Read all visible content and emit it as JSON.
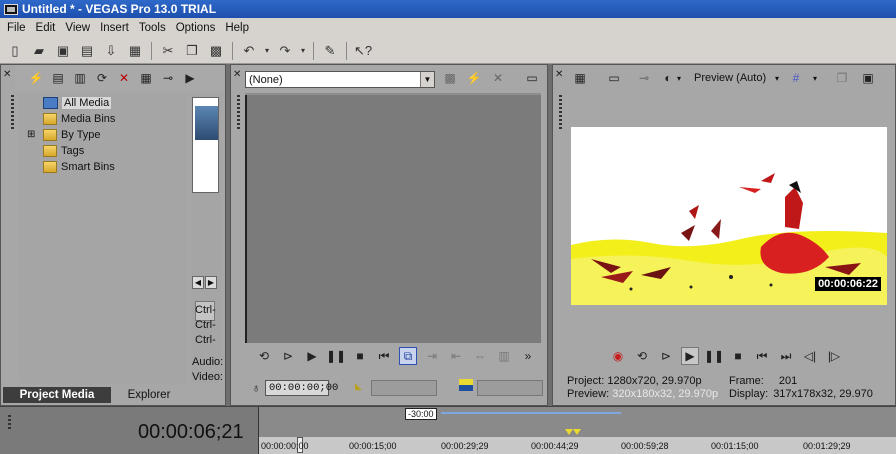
{
  "window": {
    "title": "Untitled * - VEGAS Pro 13.0 TRIAL"
  },
  "menu": [
    "File",
    "Edit",
    "View",
    "Insert",
    "Tools",
    "Options",
    "Help"
  ],
  "project_media": {
    "tree": [
      {
        "label": "All Media",
        "selected": true
      },
      {
        "label": "Media Bins"
      },
      {
        "label": "By Type",
        "expandable": true
      },
      {
        "label": "Tags"
      },
      {
        "label": "Smart Bins"
      }
    ],
    "side_labels": [
      "Ctrl-",
      "Ctrl-",
      "Ctrl-"
    ],
    "audio_label": "Audio:",
    "video_label": "Video:",
    "tabs": [
      "Project Media",
      "Explorer"
    ]
  },
  "trimmer": {
    "select_value": "(None)",
    "timecode": "00:00:00;00"
  },
  "preview": {
    "mode_label": "Preview (Auto)",
    "overlay_timecode": "00:00:06:22",
    "project_label": "Project:",
    "project_value": "1280x720, 29.970p",
    "preview_label": "Preview:",
    "preview_value": "320x180x32, 29.970p",
    "frame_label": "Frame:",
    "frame_value": "201",
    "display_label": "Display:",
    "display_value": "317x178x32, 29.970"
  },
  "timeline": {
    "current_time": "00:00:06;21",
    "loop_label": "-30:00",
    "ruler_labels": [
      "00:00:00;00",
      "00:00:15;00",
      "00:00:29;29",
      "00:00:44;29",
      "00:00:59;28",
      "00:01:15;00",
      "00:01:29;29"
    ]
  },
  "colors": {
    "titlebar": "#2f69c9",
    "menubar": "#d6d3ce",
    "panel": "#a7a7a7",
    "accent_record": "#c81e1e"
  }
}
